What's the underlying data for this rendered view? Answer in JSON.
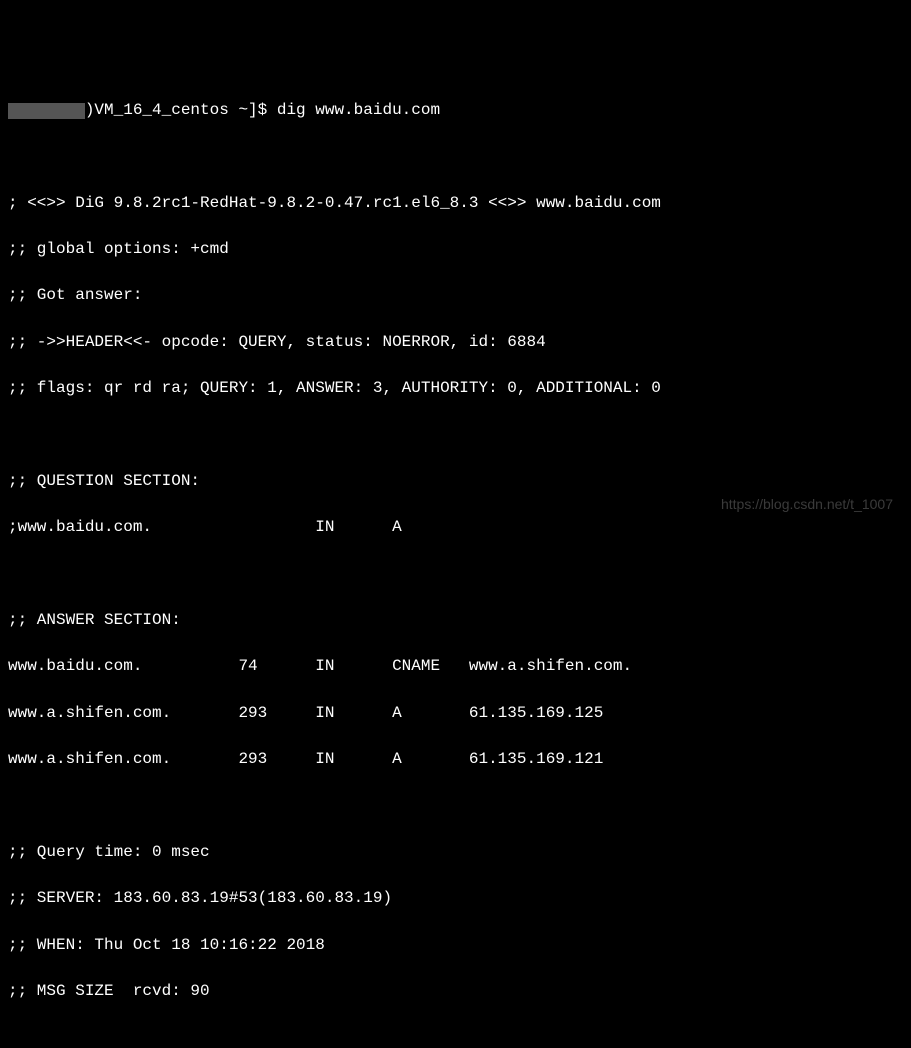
{
  "prompt": {
    "redacted_prefix": "        ",
    "host_suffix": ")VM_16_4_centos ~]$ ",
    "command": "dig www.baidu.com"
  },
  "dig": {
    "banner": "; <<>> DiG 9.8.2rc1-RedHat-9.8.2-0.47.rc1.el6_8.3 <<>> www.baidu.com",
    "global_options": ";; global options: +cmd",
    "got_answer": ";; Got answer:",
    "header": ";; ->>HEADER<<- opcode: QUERY, status: NOERROR, id: 6884",
    "flags": ";; flags: qr rd ra; QUERY: 1, ANSWER: 3, AUTHORITY: 0, ADDITIONAL: 0",
    "question_header": ";; QUESTION SECTION:",
    "question_row": ";www.baidu.com.                 IN      A",
    "answer_header": ";; ANSWER SECTION:",
    "answers": [
      "www.baidu.com.          74      IN      CNAME   www.a.shifen.com.",
      "www.a.shifen.com.       293     IN      A       61.135.169.125",
      "www.a.shifen.com.       293     IN      A       61.135.169.121"
    ],
    "query_time": ";; Query time: 0 msec",
    "server": ";; SERVER: 183.60.83.19#53(183.60.83.19)",
    "when": ";; WHEN: Thu Oct 18 10:16:22 2018",
    "msg_size": ";; MSG SIZE  rcvd: 90"
  },
  "watermark": "https://blog.csdn.net/t_1007"
}
